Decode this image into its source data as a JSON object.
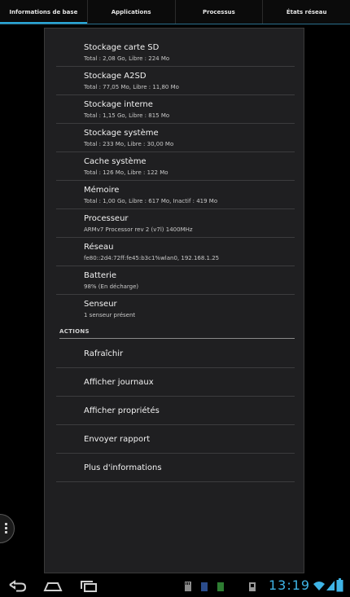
{
  "tabs": [
    {
      "label": "Informations de base",
      "active": true
    },
    {
      "label": "Applications",
      "active": false
    },
    {
      "label": "Processus",
      "active": false
    },
    {
      "label": "États réseau",
      "active": false
    }
  ],
  "info_items": [
    {
      "title": "Stockage carte SD",
      "sub": "Total : 2,08 Go, Libre : 224 Mo"
    },
    {
      "title": "Stockage A2SD",
      "sub": "Total : 77,05 Mo, Libre : 11,80 Mo"
    },
    {
      "title": "Stockage interne",
      "sub": "Total : 1,15 Go, Libre : 815 Mo"
    },
    {
      "title": "Stockage système",
      "sub": "Total : 233 Mo, Libre : 30,00 Mo"
    },
    {
      "title": "Cache système",
      "sub": "Total : 126 Mo, Libre : 122 Mo"
    },
    {
      "title": "Mémoire",
      "sub": "Total : 1,00 Go, Libre : 617 Mo, Inactif : 419 Mo"
    },
    {
      "title": "Processeur",
      "sub": "ARMv7 Processor rev 2 (v7l)  1400MHz"
    },
    {
      "title": "Réseau",
      "sub": "fe80::2d4:72ff:fe45:b3c1%wlan0, 192.168.1.25"
    },
    {
      "title": "Batterie",
      "sub": "98% (En décharge)"
    },
    {
      "title": "Senseur",
      "sub": "1 senseur présent"
    }
  ],
  "actions_header": "ACTIONS",
  "actions": [
    {
      "label": "Rafraîchir"
    },
    {
      "label": "Afficher journaux"
    },
    {
      "label": "Afficher propriétés"
    },
    {
      "label": "Envoyer rapport"
    },
    {
      "label": "Plus d'informations"
    }
  ],
  "status": {
    "clock": "13:19",
    "battery_icon": "battery-icon",
    "wifi_icon": "wifi-icon",
    "accent": "#3fb4e6"
  },
  "colors": {
    "tab_indicator": "#2aa7d8",
    "panel_bg": "#1f1f21"
  }
}
